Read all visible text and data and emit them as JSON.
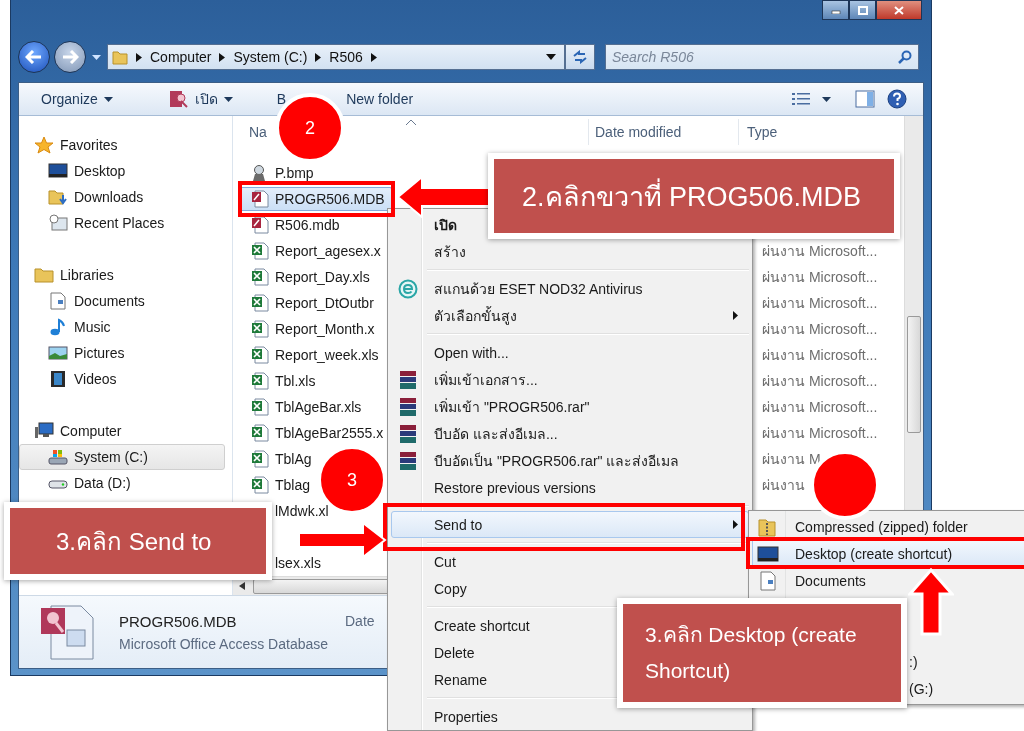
{
  "window": {
    "controls": [
      {
        "kind": "minimize"
      },
      {
        "kind": "maximize"
      },
      {
        "kind": "close"
      }
    ]
  },
  "address_bar": {
    "breadcrumbs": [
      "Computer",
      "System (C:)",
      "R506"
    ]
  },
  "search": {
    "placeholder": "Search R506"
  },
  "toolbar": {
    "items": [
      {
        "label": "Organize",
        "kind": "menu"
      },
      {
        "label": "เปิด",
        "kind": "open"
      },
      {
        "label": "B",
        "kind": "plain"
      },
      {
        "label": "New folder",
        "kind": "plain"
      }
    ]
  },
  "sidebar": {
    "groups": [
      {
        "label": "Favorites",
        "kind": "favorites",
        "children": [
          {
            "label": "Desktop",
            "kind": "desktop",
            "selected": false
          },
          {
            "label": "Downloads",
            "kind": "downloads",
            "selected": false
          },
          {
            "label": "Recent Places",
            "kind": "recent",
            "selected": false
          }
        ]
      },
      {
        "label": "Libraries",
        "kind": "libraries",
        "children": [
          {
            "label": "Documents",
            "kind": "documents",
            "selected": false
          },
          {
            "label": "Music",
            "kind": "music",
            "selected": false
          },
          {
            "label": "Pictures",
            "kind": "pictures",
            "selected": false
          },
          {
            "label": "Videos",
            "kind": "videos",
            "selected": false
          }
        ]
      },
      {
        "label": "Computer",
        "kind": "computer",
        "children": [
          {
            "label": "System (C:)",
            "kind": "system",
            "selected": true
          },
          {
            "label": "Data (D:)",
            "kind": "drive",
            "selected": false
          }
        ]
      }
    ]
  },
  "file_list": {
    "columns": [
      "Na",
      "Date modified",
      "Type"
    ],
    "rows": [
      {
        "name": "P.bmp",
        "kind": "image",
        "selected": false
      },
      {
        "name": "PROGR506.MDB",
        "kind": "access",
        "selected": true
      },
      {
        "name": "R506.mdb",
        "kind": "access",
        "selected": false
      },
      {
        "name": "Report_agesex.x",
        "kind": "excel",
        "selected": false,
        "type": "ผ่นงาน Microsoft..."
      },
      {
        "name": "Report_Day.xls",
        "kind": "excel",
        "selected": false,
        "type": "ผ่นงาน Microsoft..."
      },
      {
        "name": "Report_DtOutbr",
        "kind": "excel",
        "selected": false,
        "type": "ผ่นงาน Microsoft..."
      },
      {
        "name": "Report_Month.x",
        "kind": "excel",
        "selected": false,
        "type": "ผ่นงาน Microsoft..."
      },
      {
        "name": "Report_week.xls",
        "kind": "excel",
        "selected": false,
        "type": "ผ่นงาน Microsoft..."
      },
      {
        "name": "Tbl.xls",
        "kind": "excel",
        "selected": false,
        "type": "ผ่นงาน Microsoft..."
      },
      {
        "name": "TblAgeBar.xls",
        "kind": "excel",
        "selected": false,
        "type": "ผ่นงาน Microsoft..."
      },
      {
        "name": "TblAgeBar2555.x",
        "kind": "excel",
        "selected": false,
        "type": "ผ่นงาน Microsoft..."
      },
      {
        "name": "TblAg",
        "kind": "excel",
        "selected": false,
        "type": "ผ่นงาน M"
      },
      {
        "name": "Tblag",
        "kind": "excel",
        "selected": false,
        "type": "ผ่นงาน"
      },
      {
        "name": "lMdwk.xl",
        "kind": "cut",
        "selected": false
      },
      {
        "name": "lsex.xls",
        "kind": "cut",
        "selected": false
      }
    ]
  },
  "details": {
    "name": "PROGR506.MDB",
    "type": "Microsoft Office Access Database",
    "date_label": "Date"
  },
  "context_menu": {
    "items": [
      {
        "kind": "default",
        "label": "เปิด",
        "selected": false
      },
      {
        "kind": "item",
        "label": "สร้าง",
        "selected": false
      },
      {
        "kind": "separator"
      },
      {
        "kind": "eset",
        "label": "สแกนด้วย ESET NOD32 Antivirus",
        "selected": false
      },
      {
        "kind": "item",
        "label": "ตัวเลือกขั้นสูง",
        "submenu": true,
        "selected": false
      },
      {
        "kind": "separator"
      },
      {
        "kind": "item",
        "label": "Open with...",
        "selected": false
      },
      {
        "kind": "rar",
        "label": "เพิ่มเข้าเอกสาร...",
        "selected": false
      },
      {
        "kind": "rar",
        "label": "เพิ่มเข้า \"PROGR506.rar\"",
        "selected": false
      },
      {
        "kind": "rar",
        "label": "บีบอัด และส่งอีเมล...",
        "selected": false
      },
      {
        "kind": "rar",
        "label": "บีบอัดเป็น \"PROGR506.rar\" และส่งอีเมล",
        "selected": false
      },
      {
        "kind": "item",
        "label": "Restore previous versions",
        "selected": false
      },
      {
        "kind": "separator"
      },
      {
        "kind": "item",
        "label": "Send to",
        "submenu": true,
        "selected": true
      },
      {
        "kind": "separator"
      },
      {
        "kind": "item",
        "label": "Cut",
        "selected": false
      },
      {
        "kind": "item",
        "label": "Copy",
        "selected": false
      },
      {
        "kind": "separator"
      },
      {
        "kind": "item",
        "label": "Create shortcut",
        "selected": false
      },
      {
        "kind": "item",
        "label": "Delete",
        "selected": false
      },
      {
        "kind": "item",
        "label": "Rename",
        "selected": false
      },
      {
        "kind": "separator"
      },
      {
        "kind": "item",
        "label": "Properties",
        "selected": false
      }
    ]
  },
  "send_to_menu": {
    "items": [
      {
        "label": "Compressed (zipped) folder",
        "kind": "zip",
        "selected": false
      },
      {
        "label": "Desktop (create shortcut)",
        "kind": "desktop",
        "selected": true
      },
      {
        "label": "Documents",
        "kind": "documents",
        "selected": false
      },
      {
        "label": ":)",
        "kind": "partial",
        "selected": false
      },
      {
        "label": "(G:)",
        "kind": "partial",
        "selected": false
      }
    ]
  },
  "step_markers": [
    "2",
    "3"
  ],
  "callouts": [
    "2.คลิกขวาที่ PROG506.MDB",
    "3.คลิก Send to",
    "3.คลิก Desktop (create Shortcut)"
  ]
}
